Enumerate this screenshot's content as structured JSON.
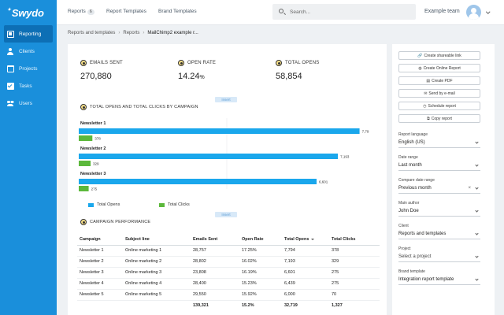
{
  "app": {
    "logo_text": "Swydo"
  },
  "sidebar": {
    "items": [
      {
        "label": "Reporting",
        "icon": "report-icon",
        "active": true
      },
      {
        "label": "Clients",
        "icon": "clients-icon",
        "active": false
      },
      {
        "label": "Projects",
        "icon": "folder-icon",
        "active": false
      },
      {
        "label": "Tasks",
        "icon": "check-icon",
        "active": false
      },
      {
        "label": "Users",
        "icon": "users-icon",
        "active": false
      }
    ]
  },
  "topbar": {
    "tabs": [
      {
        "label": "Reports",
        "badge": "6"
      },
      {
        "label": "Report Templates"
      },
      {
        "label": "Brand Templates"
      }
    ],
    "search_placeholder": "Search...",
    "team_name": "Example team"
  },
  "breadcrumb": [
    "Reports and templates",
    "Reports",
    "MailChimp2 example r..."
  ],
  "report": {
    "kpis": [
      {
        "label": "EMAILS SENT",
        "value": "270,880",
        "unit": ""
      },
      {
        "label": "OPEN RATE",
        "value": "14.24",
        "unit": "%"
      },
      {
        "label": "TOTAL OPENS",
        "value": "58,854",
        "unit": ""
      }
    ],
    "insert_label": "Insert",
    "chart_title": "TOTAL OPENS AND TOTAL CLICKS BY CAMPAIGN",
    "table_title": "CAMPAIGN PERFORMANCE",
    "table": {
      "headers": [
        "Campaign",
        "Subject line",
        "Emails Sent",
        "Open Rate",
        "Total Opens",
        "Total Clicks"
      ],
      "rows": [
        [
          "Newsletter 1",
          "Online marketing 1",
          "28,757",
          "17.25%",
          "7,794",
          "378"
        ],
        [
          "Newsletter 2",
          "Online marketing 2",
          "28,802",
          "16.02%",
          "7,193",
          "329"
        ],
        [
          "Newsletter 3",
          "Online marketing 3",
          "23,808",
          "16.19%",
          "6,601",
          "275"
        ],
        [
          "Newsletter 4",
          "Online marketing 4",
          "28,400",
          "15.23%",
          "6,439",
          "275"
        ],
        [
          "Newsletter 5",
          "Online marketing 5",
          "29,550",
          "15.92%",
          "6,000",
          "70"
        ]
      ],
      "totals": [
        "",
        "",
        "139,321",
        "15.2%",
        "32,719",
        "1,327"
      ]
    }
  },
  "chart_data": {
    "type": "bar",
    "orientation": "horizontal",
    "title": "TOTAL OPENS AND TOTAL CLICKS BY CAMPAIGN",
    "categories": [
      "Newsletter 1",
      "Newsletter 2",
      "Newsletter 3"
    ],
    "series": [
      {
        "name": "Total Opens",
        "values": [
          7794,
          7193,
          6601
        ],
        "labels": [
          "7,79",
          "7,193",
          "6,601"
        ],
        "color": "#1aa7ec"
      },
      {
        "name": "Total Clicks",
        "values": [
          378,
          329,
          275
        ],
        "labels": [
          "378",
          "329",
          "275"
        ],
        "color": "#5cb83b"
      }
    ],
    "legend": "bottom",
    "grid": false
  },
  "settings": {
    "actions": [
      {
        "label": "Create shareable link",
        "icon": "link-icon",
        "glyph": "🔗"
      },
      {
        "label": "Create Online Report",
        "icon": "globe-icon",
        "glyph": "◍"
      },
      {
        "label": "Create PDF",
        "icon": "pdf-icon",
        "glyph": "▤"
      },
      {
        "label": "Send by e-mail",
        "icon": "mail-icon",
        "glyph": "✉"
      },
      {
        "label": "Schedule report",
        "icon": "clock-icon",
        "glyph": "◷"
      },
      {
        "label": "Copy report",
        "icon": "copy-icon",
        "glyph": "⧉"
      }
    ],
    "fields": [
      {
        "label": "Report language",
        "value": "English (US)"
      },
      {
        "label": "Date range",
        "value": "Last month"
      },
      {
        "label": "Compare date range",
        "value": "Previous month",
        "clearable": true
      },
      {
        "label": "Main author",
        "value": "John Doe"
      },
      {
        "label": "Client",
        "value": "Reports and templates"
      },
      {
        "label": "Project",
        "value": "Select a project",
        "placeholder": true
      },
      {
        "label": "Brand template",
        "value": "Integration report template"
      }
    ]
  }
}
